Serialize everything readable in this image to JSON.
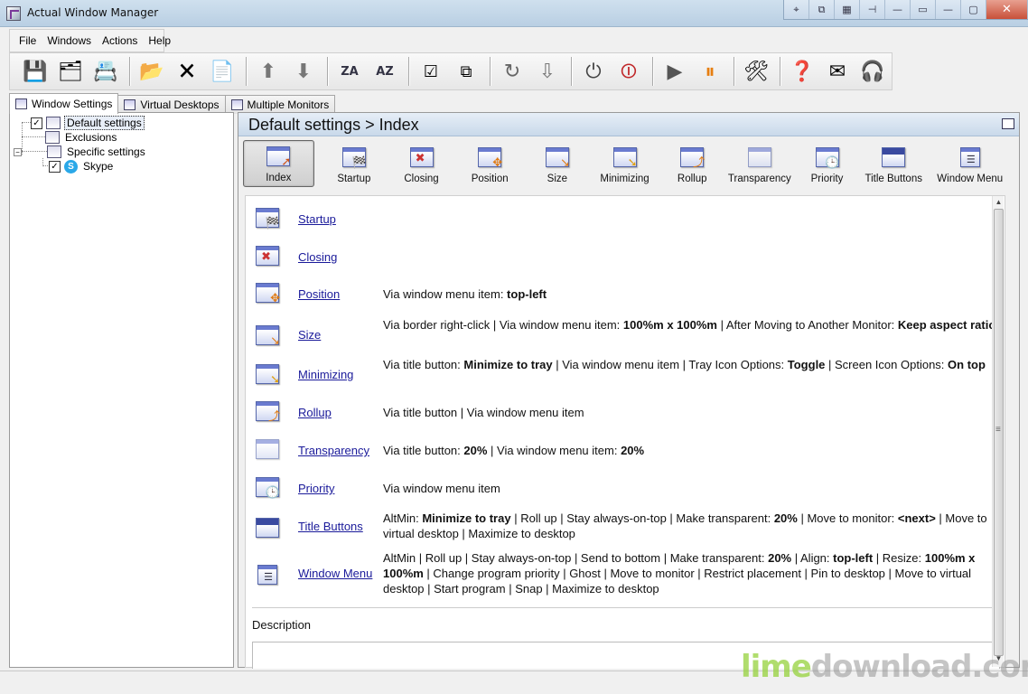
{
  "window": {
    "title": "Actual Window Manager"
  },
  "title_controls": [
    "⌖",
    "⧉",
    "▦",
    "⊣",
    "—",
    "▭",
    "—",
    "▢",
    "✕"
  ],
  "menu": [
    "File",
    "Windows",
    "Actions",
    "Help"
  ],
  "toolbar_icons": [
    "save-icon",
    "settings-config-icon",
    "settings-export-icon",
    "new-setting-icon",
    "delete-setting-icon",
    "copy-setting-icon",
    "move-up-icon",
    "move-down-icon",
    "sort-az-icon",
    "sort-za-icon",
    "check-all-icon",
    "cascade-icon",
    "undo-icon",
    "reload-icon",
    "power-icon",
    "stop-icon",
    "play-icon",
    "pause-icon",
    "tools-icon",
    "help-icon",
    "email-icon",
    "support-icon"
  ],
  "tabs": [
    "Window Settings",
    "Virtual Desktops",
    "Multiple Monitors"
  ],
  "tree": {
    "default": "Default settings",
    "exclusions": "Exclusions",
    "specific": "Specific settings",
    "skype": "Skype"
  },
  "breadcrumb": "Default settings > Index",
  "categories": [
    "Index",
    "Startup",
    "Closing",
    "Position",
    "Size",
    "Minimizing",
    "Rollup",
    "Transparency",
    "Priority",
    "Title Buttons",
    "Window Menu"
  ],
  "rows": [
    {
      "link": "Startup"
    },
    {
      "link": "Closing"
    },
    {
      "link": "Position",
      "d0": "Via window menu item: ",
      "b0": "top-left"
    },
    {
      "link": "Size",
      "d0": "Via border right-click | Via window menu item: ",
      "b0": "100%m x 100%m",
      "d1": " | After Moving to Another Monitor: ",
      "b1": "Keep aspect ratio"
    },
    {
      "link": "Minimizing",
      "d0": "Via title button: ",
      "b0": "Minimize to tray",
      "d1": " | Via window menu item | Tray Icon Options: ",
      "b1": "Toggle",
      "d2": " | Screen Icon Options: ",
      "b2": "On top"
    },
    {
      "link": "Rollup",
      "d0": "Via title button | Via window menu item"
    },
    {
      "link": "Transparency",
      "d0": "Via title button: ",
      "b0": "20%",
      "d1": " | Via window menu item: ",
      "b1": "20%"
    },
    {
      "link": "Priority",
      "d0": "Via window menu item"
    },
    {
      "link": "Title Buttons",
      "d0": "AltMin: ",
      "b0": "Minimize to tray",
      "d1": " | Roll up | Stay always-on-top | Make transparent: ",
      "b1": "20%",
      "d2": " | Move to monitor: ",
      "b2": "<next>",
      "d3": " | Move to virtual desktop | Maximize to desktop"
    },
    {
      "link": "Window Menu",
      "d0": "AltMin | Roll up | Stay always-on-top | Send to bottom | Make transparent: ",
      "b0": "20%",
      "d1": " | Align: ",
      "b1": "top-left",
      "d2": " | Resize: ",
      "b2": "100%m x 100%m",
      "d3": " | Change program priority | Ghost | Move to monitor | Restrict placement | Pin to desktop | Move to virtual desktop | Start program | Snap | Maximize to desktop"
    }
  ],
  "description_label": "Description",
  "watermark": {
    "lime": "lime",
    "rest": "download.com"
  }
}
